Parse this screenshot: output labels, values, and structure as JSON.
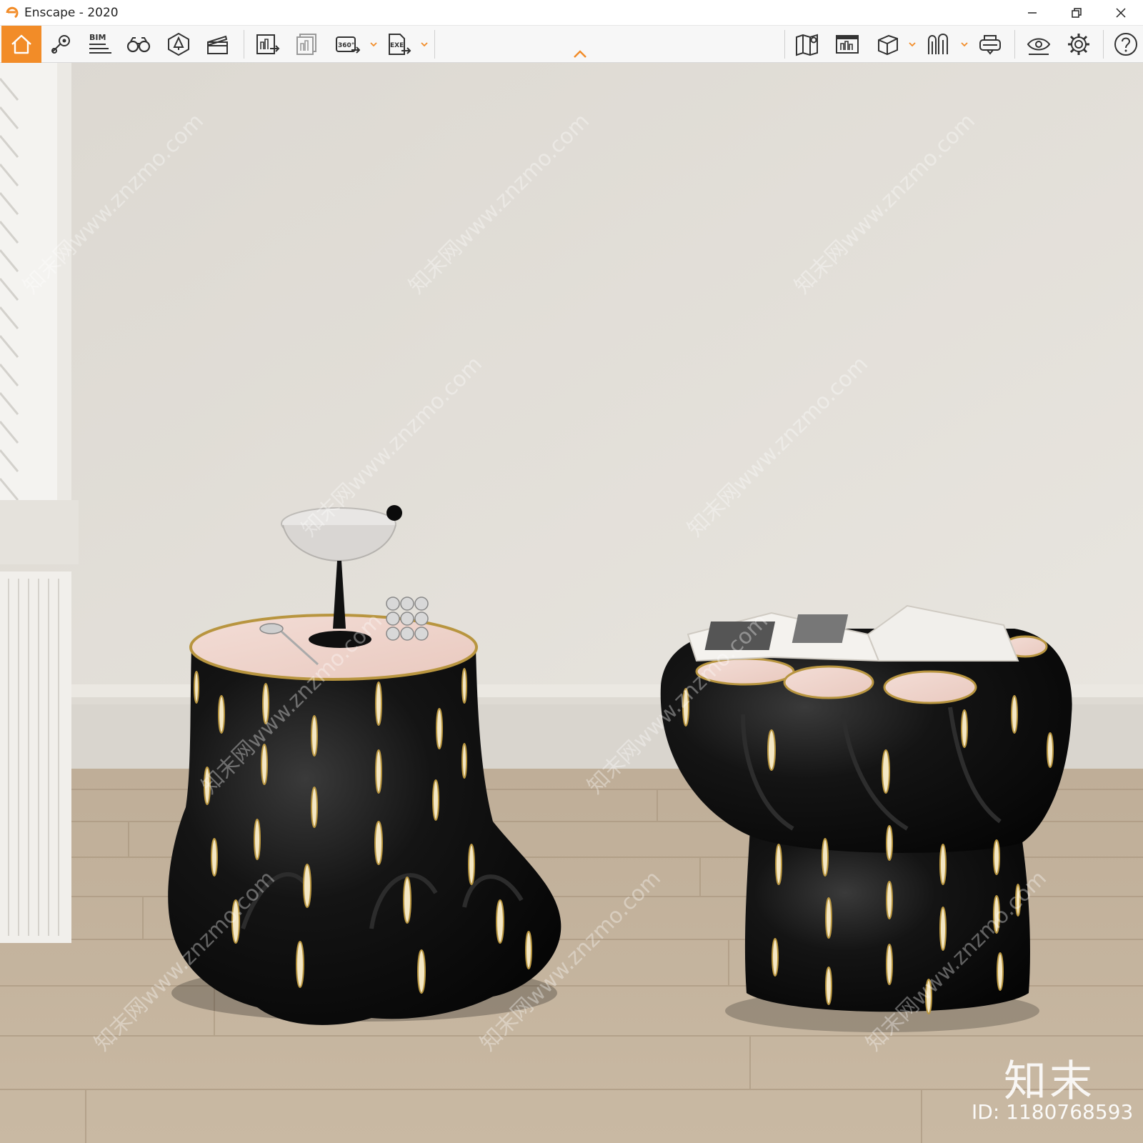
{
  "window": {
    "title": "Enscape - 2020"
  },
  "toolbar": {
    "left_buttons": [
      "home-icon",
      "views-icon",
      "bim-icon",
      "binoculars-icon",
      "asset-library-icon",
      "video-editor-icon"
    ],
    "render_buttons": [
      "render-screenshot-icon",
      "batch-render-icon",
      "render-panorama-icon",
      "export-exe-icon"
    ],
    "bim_label": "BIM",
    "panorama_label": "360°",
    "exe_label": "EXE",
    "right_buttons": [
      "map-icon",
      "screenshot-gallery-icon",
      "cube-icon",
      "split-view-icon",
      "vr-headset-icon",
      "visual-settings-icon",
      "settings-gear-icon",
      "help-icon"
    ],
    "accent_color": "#f28c28"
  },
  "watermark": {
    "logo_text": "知末",
    "id_text": "ID: 1180768593",
    "diagonal_text": "知末网www.znzmo.com"
  }
}
